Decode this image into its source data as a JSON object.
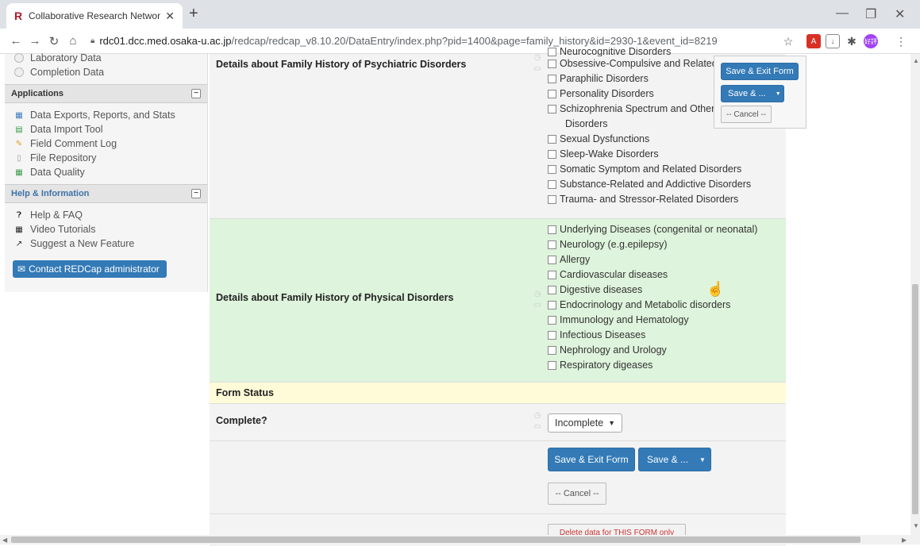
{
  "browser": {
    "tab_title": "Collaborative Research Network",
    "url_host": "rdc01.dcc.med.osaka-u.ac.jp",
    "url_path": "/redcap/redcap_v8.10.20/DataEntry/index.php?pid=1400&page=family_history&id=2930-1&event_id=8219",
    "ext_label": "好評"
  },
  "sidebar": {
    "top_items": [
      "Laboratory Data",
      "Completion Data"
    ],
    "applications_title": "Applications",
    "applications": [
      "Data Exports, Reports, and Stats",
      "Data Import Tool",
      "Field Comment Log",
      "File Repository",
      "Data Quality"
    ],
    "help_title": "Help & Information",
    "help_items": [
      "Help & FAQ",
      "Video Tutorials",
      "Suggest a New Feature"
    ],
    "contact_button": "Contact REDCap administrator"
  },
  "form": {
    "psychiatric_label": "Details about Family History of Psychiatric Disorders",
    "psychiatric_options": [
      "Neurocognitive Disorders",
      "Obsessive-Compulsive and Related",
      "Paraphilic Disorders",
      "Personality Disorders",
      "Schizophrenia Spectrum and Other",
      "Disorders",
      "Sexual Dysfunctions",
      "Sleep-Wake Disorders",
      "Somatic Symptom and Related Disorders",
      "Substance-Related and Addictive Disorders",
      "Trauma- and Stressor-Related Disorders"
    ],
    "physical_label": "Details about Family History of Physical Disorders",
    "physical_options": [
      "Underlying Diseases (congenital or neonatal)",
      "Neurology (e.g.epilepsy)",
      "Allergy",
      "Cardiovascular diseases",
      "Digestive diseases",
      "Endocrinology and Metabolic disorders",
      "Immunology and Hematology",
      "Infectious Diseases",
      "Nephrology and Urology",
      "Respiratory digeases"
    ],
    "status_header": "Form Status",
    "complete_label": "Complete?",
    "complete_value": "Incomplete",
    "save_exit": "Save & Exit Form",
    "save_more": "Save & ...",
    "cancel": "-- Cancel --",
    "delete_partial": "Delete data for THIS FORM only"
  },
  "colors": {
    "primary": "#337ab7",
    "green_row": "#def4dc",
    "yellow_row": "#fffbd8"
  }
}
